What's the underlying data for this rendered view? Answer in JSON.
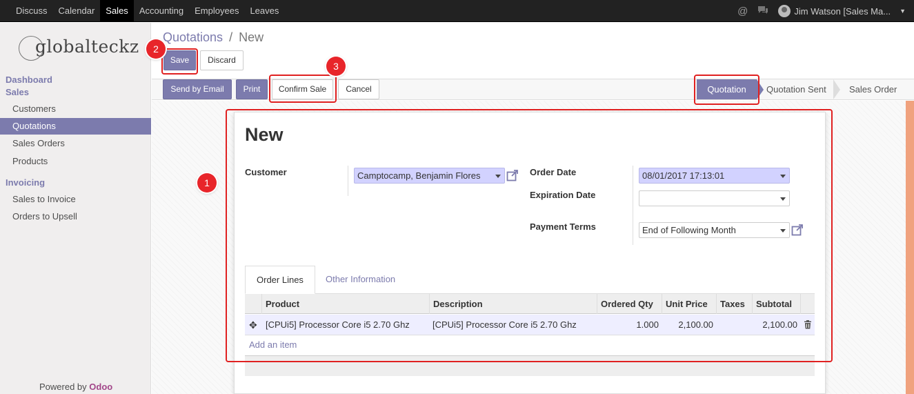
{
  "topbar": {
    "menu": [
      "Discuss",
      "Calendar",
      "Sales",
      "Accounting",
      "Employees",
      "Leaves"
    ],
    "active": "Sales",
    "user": "Jim Watson [Sales Ma..."
  },
  "sidebar": {
    "logo_text": "globalteckz",
    "sections": [
      {
        "label": "Dashboard"
      },
      {
        "label": "Sales",
        "items": [
          "Customers",
          "Quotations",
          "Sales Orders",
          "Products"
        ]
      },
      {
        "label": "Invoicing",
        "items": [
          "Sales to Invoice",
          "Orders to Upsell"
        ]
      }
    ],
    "active_item": "Quotations",
    "powered_by": "Powered by",
    "powered_brand": "Odoo"
  },
  "breadcrumb": {
    "parent": "Quotations",
    "sep": "/",
    "current": "New"
  },
  "buttons": {
    "save": "Save",
    "discard": "Discard",
    "send_email": "Send by Email",
    "print": "Print",
    "confirm_sale": "Confirm Sale",
    "cancel": "Cancel"
  },
  "stages": [
    "Quotation",
    "Quotation Sent",
    "Sales Order"
  ],
  "active_stage": "Quotation",
  "form": {
    "title": "New",
    "customer_label": "Customer",
    "customer_value": "Camptocamp, Benjamin Flores",
    "order_date_label": "Order Date",
    "order_date_value": "08/01/2017 17:13:01",
    "expiration_label": "Expiration Date",
    "expiration_value": "",
    "payment_terms_label": "Payment Terms",
    "payment_terms_value": "End of Following Month"
  },
  "tabs": [
    "Order Lines",
    "Other Information"
  ],
  "table": {
    "headers": [
      "Product",
      "Description",
      "Ordered Qty",
      "Unit Price",
      "Taxes",
      "Subtotal"
    ],
    "rows": [
      {
        "product": "[CPUi5] Processor Core i5 2.70 Ghz",
        "description": "[CPUi5] Processor Core i5 2.70 Ghz",
        "qty": "1.000",
        "unit_price": "2,100.00",
        "taxes": "",
        "subtotal": "2,100.00"
      }
    ],
    "add_item": "Add an item"
  },
  "annotations": [
    "1",
    "2",
    "3"
  ],
  "colors": {
    "accent": "#7c7bad",
    "annotation": "#e8252a",
    "topbar": "#222222"
  }
}
